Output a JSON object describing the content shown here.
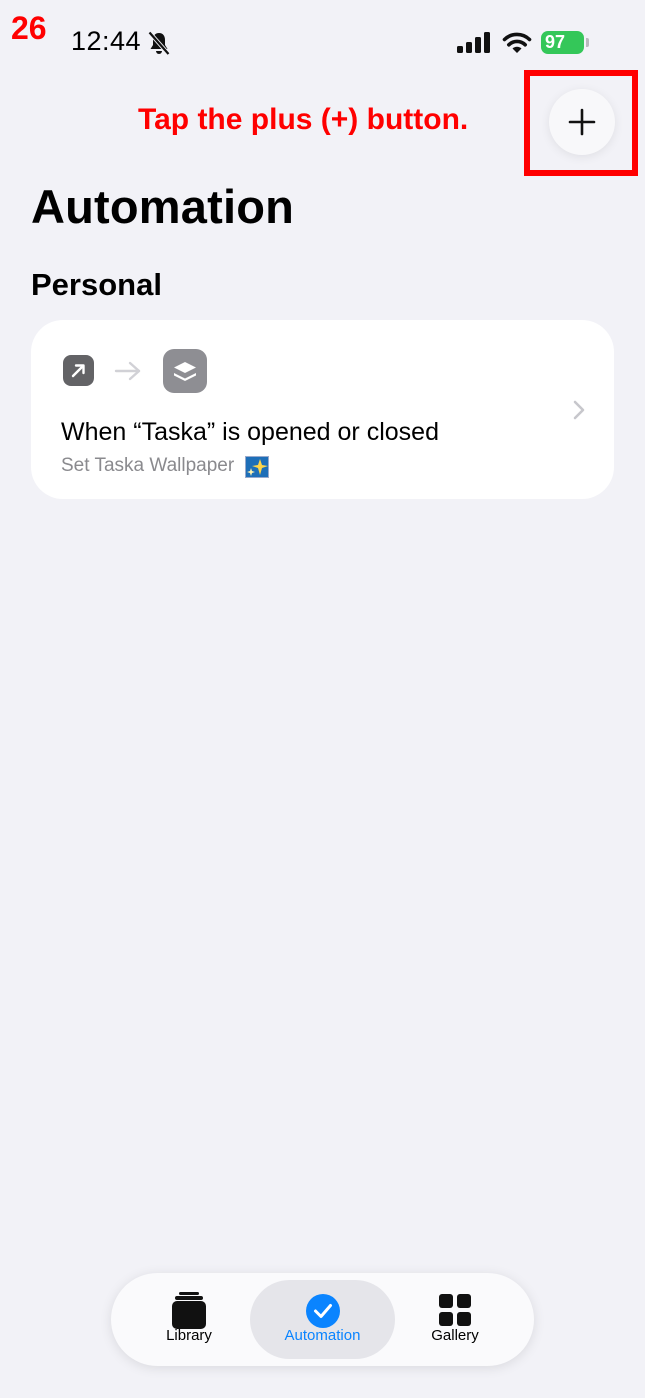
{
  "tutorial": {
    "step_number": "26",
    "instruction": "Tap the plus (+) button."
  },
  "status_bar": {
    "time": "12:44",
    "battery": "97"
  },
  "header": {
    "add_button_icon": "plus-icon"
  },
  "page": {
    "title": "Automation",
    "section_title": "Personal"
  },
  "automation_card": {
    "trigger_icon": "open-app-arrow-icon",
    "action_icon": "shortcuts-app-icon",
    "title": "When “Taska” is opened or closed",
    "subtitle": "Set Taska Wallpaper",
    "subtitle_emoji_icon": "sparkle-image-icon"
  },
  "tab_bar": {
    "selected": "Automation",
    "tabs": [
      {
        "label": "Library",
        "icon": "library-stack-icon"
      },
      {
        "label": "Automation",
        "icon": "automation-check-icon"
      },
      {
        "label": "Gallery",
        "icon": "gallery-grid-icon"
      }
    ]
  },
  "colors": {
    "background": "#F2F2F7",
    "tutorial_red": "#FF0000",
    "accent_blue": "#0A84FF",
    "battery_green": "#34C759",
    "card_background": "#FFFFFF",
    "selected_tab_background": "#E5E5EA"
  }
}
